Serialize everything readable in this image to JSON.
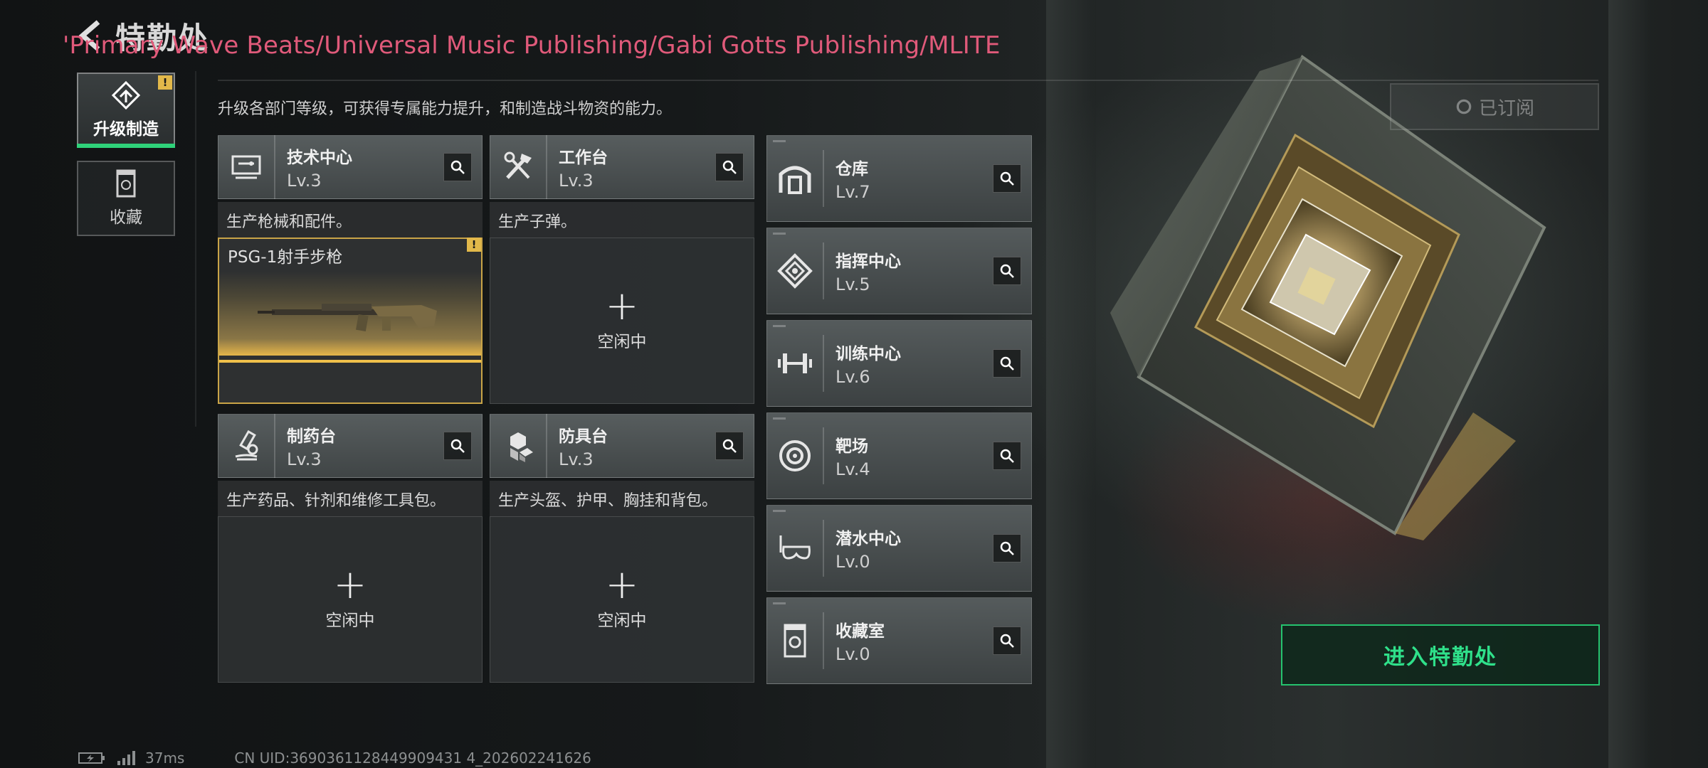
{
  "header": {
    "title": "特勤处",
    "credits_overlay": "'Primary Wave Beats/Universal Music Publishing/Gabi Gotts Publishing/MLITE",
    "subtitle": "升级各部门等级，可获得专属能力提升，和制造战斗物资的能力。"
  },
  "tabs": [
    {
      "label": "升级制造",
      "active": true,
      "icon": "upgrade-icon",
      "alert": "!"
    },
    {
      "label": "收藏",
      "active": false,
      "icon": "collection-icon"
    }
  ],
  "stations": [
    {
      "name": "技术中心",
      "level": "Lv.3",
      "desc": "生产枪械和配件。",
      "icon": "tech-center-icon",
      "slot": {
        "busy": true,
        "item": "PSG-1射手步枪",
        "alert": "!"
      }
    },
    {
      "name": "工作台",
      "level": "Lv.3",
      "desc": "生产子弹。",
      "icon": "workbench-icon",
      "slot": {
        "busy": false,
        "plus": "+",
        "status": "空闲中"
      }
    },
    {
      "name": "制药台",
      "level": "Lv.3",
      "desc": "生产药品、针剂和维修工具包。",
      "icon": "pharmacy-icon",
      "slot": {
        "busy": false,
        "plus": "+",
        "status": "空闲中"
      }
    },
    {
      "name": "防具台",
      "level": "Lv.3",
      "desc": "生产头盔、护甲、胸挂和背包。",
      "icon": "armor-bench-icon",
      "slot": {
        "busy": false,
        "plus": "+",
        "status": "空闲中"
      }
    }
  ],
  "departments": [
    {
      "name": "仓库",
      "level": "Lv.7",
      "icon": "warehouse-icon"
    },
    {
      "name": "指挥中心",
      "level": "Lv.5",
      "icon": "command-center-icon"
    },
    {
      "name": "训练中心",
      "level": "Lv.6",
      "icon": "training-center-icon"
    },
    {
      "name": "靶场",
      "level": "Lv.4",
      "icon": "shooting-range-icon"
    },
    {
      "name": "潜水中心",
      "level": "Lv.0",
      "icon": "diving-center-icon"
    },
    {
      "name": "收藏室",
      "level": "Lv.0",
      "icon": "collection-room-icon"
    }
  ],
  "actions": {
    "subscribed": "已订阅",
    "enter": "进入特勤处"
  },
  "status_bar": {
    "ping": "37ms",
    "uid": "CN UID:3690361128449909431 4_202602241626"
  },
  "colors": {
    "accent_green": "#2fe08a",
    "alert_yellow": "#e2b84a",
    "credits_pink": "#e05a7a"
  }
}
